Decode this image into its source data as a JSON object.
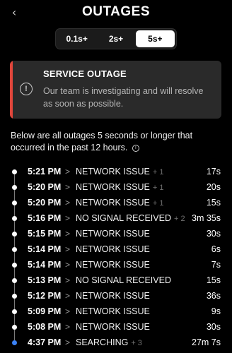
{
  "header": {
    "title": "OUTAGES",
    "back_glyph": "‹"
  },
  "filters": [
    {
      "label": "0.1s+",
      "active": false
    },
    {
      "label": "2s+",
      "active": false
    },
    {
      "label": "5s+",
      "active": true
    }
  ],
  "alert": {
    "title": "SERVICE OUTAGE",
    "message": "Our team is investigating and will resolve as soon as possible.",
    "icon": "!",
    "accent_color": "#e0463b"
  },
  "description": "Below are all outages 5 seconds or longer that occurred in the past 12 hours.",
  "info_icon": "i",
  "outages": [
    {
      "time": "5:21 PM",
      "label": "NETWORK ISSUE",
      "extra": "+ 1",
      "duration": "17s"
    },
    {
      "time": "5:20 PM",
      "label": "NETWORK ISSUE",
      "extra": "+ 1",
      "duration": "20s"
    },
    {
      "time": "5:20 PM",
      "label": "NETWORK ISSUE",
      "extra": "+ 1",
      "duration": "15s"
    },
    {
      "time": "5:16 PM",
      "label": "NO SIGNAL RECEIVED",
      "extra": "+ 2",
      "duration": "3m 35s"
    },
    {
      "time": "5:15 PM",
      "label": "NETWORK ISSUE",
      "extra": "",
      "duration": "30s"
    },
    {
      "time": "5:14 PM",
      "label": "NETWORK ISSUE",
      "extra": "",
      "duration": "6s"
    },
    {
      "time": "5:14 PM",
      "label": "NETWORK ISSUE",
      "extra": "",
      "duration": "7s"
    },
    {
      "time": "5:13 PM",
      "label": "NO SIGNAL RECEIVED",
      "extra": "",
      "duration": "15s"
    },
    {
      "time": "5:12 PM",
      "label": "NETWORK ISSUE",
      "extra": "",
      "duration": "36s"
    },
    {
      "time": "5:09 PM",
      "label": "NETWORK ISSUE",
      "extra": "",
      "duration": "9s"
    },
    {
      "time": "5:08 PM",
      "label": "NETWORK ISSUE",
      "extra": "",
      "duration": "30s"
    },
    {
      "time": "4:37 PM",
      "label": "SEARCHING",
      "extra": "+ 3",
      "duration": "27m 7s",
      "dot_color": "#3b82f6"
    }
  ]
}
